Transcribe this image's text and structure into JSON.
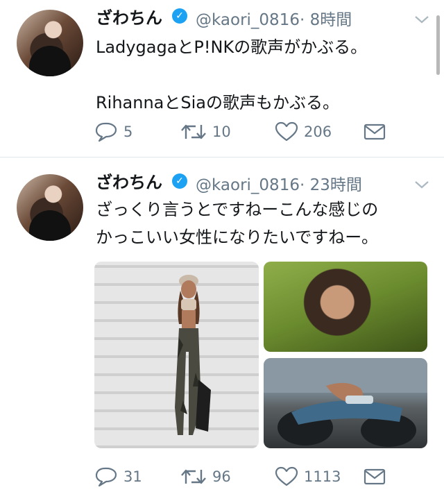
{
  "tweets": [
    {
      "display_name": "ざわちん",
      "handle": "@kaori_0816",
      "time": "· 8時間",
      "lines": [
        "LadygagaとP!NKの歌声がかぶる。",
        "",
        "RihannaとSiaの歌声もかぶる。"
      ],
      "replies": "5",
      "retweets": "10",
      "likes": "206"
    },
    {
      "display_name": "ざわちん",
      "handle": "@kaori_0816",
      "time": "· 23時間",
      "lines": [
        "ざっくり言うとですねーこんな感じの",
        "かっこいい女性になりたいですねー。"
      ],
      "replies": "31",
      "retweets": "96",
      "likes": "1113"
    }
  ],
  "colors": {
    "text": "#14171a",
    "secondary": "#657786",
    "verified": "#1da1f2",
    "divider": "#e1e8ed"
  },
  "icons": [
    "verified-badge-icon",
    "chevron-down-icon",
    "reply-icon",
    "retweet-icon",
    "like-icon",
    "share-icon"
  ]
}
